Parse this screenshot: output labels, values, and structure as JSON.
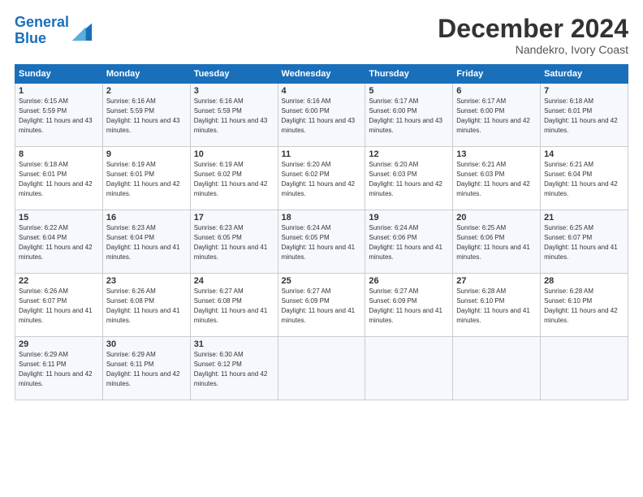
{
  "header": {
    "logo_general": "General",
    "logo_blue": "Blue",
    "title": "December 2024",
    "subtitle": "Nandekro, Ivory Coast"
  },
  "columns": [
    "Sunday",
    "Monday",
    "Tuesday",
    "Wednesday",
    "Thursday",
    "Friday",
    "Saturday"
  ],
  "weeks": [
    [
      {
        "day": "1",
        "sunrise": "6:15 AM",
        "sunset": "5:59 PM",
        "daylight": "11 hours and 43 minutes."
      },
      {
        "day": "2",
        "sunrise": "6:16 AM",
        "sunset": "5:59 PM",
        "daylight": "11 hours and 43 minutes."
      },
      {
        "day": "3",
        "sunrise": "6:16 AM",
        "sunset": "5:59 PM",
        "daylight": "11 hours and 43 minutes."
      },
      {
        "day": "4",
        "sunrise": "6:16 AM",
        "sunset": "6:00 PM",
        "daylight": "11 hours and 43 minutes."
      },
      {
        "day": "5",
        "sunrise": "6:17 AM",
        "sunset": "6:00 PM",
        "daylight": "11 hours and 43 minutes."
      },
      {
        "day": "6",
        "sunrise": "6:17 AM",
        "sunset": "6:00 PM",
        "daylight": "11 hours and 42 minutes."
      },
      {
        "day": "7",
        "sunrise": "6:18 AM",
        "sunset": "6:01 PM",
        "daylight": "11 hours and 42 minutes."
      }
    ],
    [
      {
        "day": "8",
        "sunrise": "6:18 AM",
        "sunset": "6:01 PM",
        "daylight": "11 hours and 42 minutes."
      },
      {
        "day": "9",
        "sunrise": "6:19 AM",
        "sunset": "6:01 PM",
        "daylight": "11 hours and 42 minutes."
      },
      {
        "day": "10",
        "sunrise": "6:19 AM",
        "sunset": "6:02 PM",
        "daylight": "11 hours and 42 minutes."
      },
      {
        "day": "11",
        "sunrise": "6:20 AM",
        "sunset": "6:02 PM",
        "daylight": "11 hours and 42 minutes."
      },
      {
        "day": "12",
        "sunrise": "6:20 AM",
        "sunset": "6:03 PM",
        "daylight": "11 hours and 42 minutes."
      },
      {
        "day": "13",
        "sunrise": "6:21 AM",
        "sunset": "6:03 PM",
        "daylight": "11 hours and 42 minutes."
      },
      {
        "day": "14",
        "sunrise": "6:21 AM",
        "sunset": "6:04 PM",
        "daylight": "11 hours and 42 minutes."
      }
    ],
    [
      {
        "day": "15",
        "sunrise": "6:22 AM",
        "sunset": "6:04 PM",
        "daylight": "11 hours and 42 minutes."
      },
      {
        "day": "16",
        "sunrise": "6:23 AM",
        "sunset": "6:04 PM",
        "daylight": "11 hours and 41 minutes."
      },
      {
        "day": "17",
        "sunrise": "6:23 AM",
        "sunset": "6:05 PM",
        "daylight": "11 hours and 41 minutes."
      },
      {
        "day": "18",
        "sunrise": "6:24 AM",
        "sunset": "6:05 PM",
        "daylight": "11 hours and 41 minutes."
      },
      {
        "day": "19",
        "sunrise": "6:24 AM",
        "sunset": "6:06 PM",
        "daylight": "11 hours and 41 minutes."
      },
      {
        "day": "20",
        "sunrise": "6:25 AM",
        "sunset": "6:06 PM",
        "daylight": "11 hours and 41 minutes."
      },
      {
        "day": "21",
        "sunrise": "6:25 AM",
        "sunset": "6:07 PM",
        "daylight": "11 hours and 41 minutes."
      }
    ],
    [
      {
        "day": "22",
        "sunrise": "6:26 AM",
        "sunset": "6:07 PM",
        "daylight": "11 hours and 41 minutes."
      },
      {
        "day": "23",
        "sunrise": "6:26 AM",
        "sunset": "6:08 PM",
        "daylight": "11 hours and 41 minutes."
      },
      {
        "day": "24",
        "sunrise": "6:27 AM",
        "sunset": "6:08 PM",
        "daylight": "11 hours and 41 minutes."
      },
      {
        "day": "25",
        "sunrise": "6:27 AM",
        "sunset": "6:09 PM",
        "daylight": "11 hours and 41 minutes."
      },
      {
        "day": "26",
        "sunrise": "6:27 AM",
        "sunset": "6:09 PM",
        "daylight": "11 hours and 41 minutes."
      },
      {
        "day": "27",
        "sunrise": "6:28 AM",
        "sunset": "6:10 PM",
        "daylight": "11 hours and 41 minutes."
      },
      {
        "day": "28",
        "sunrise": "6:28 AM",
        "sunset": "6:10 PM",
        "daylight": "11 hours and 42 minutes."
      }
    ],
    [
      {
        "day": "29",
        "sunrise": "6:29 AM",
        "sunset": "6:11 PM",
        "daylight": "11 hours and 42 minutes."
      },
      {
        "day": "30",
        "sunrise": "6:29 AM",
        "sunset": "6:11 PM",
        "daylight": "11 hours and 42 minutes."
      },
      {
        "day": "31",
        "sunrise": "6:30 AM",
        "sunset": "6:12 PM",
        "daylight": "11 hours and 42 minutes."
      },
      null,
      null,
      null,
      null
    ]
  ]
}
